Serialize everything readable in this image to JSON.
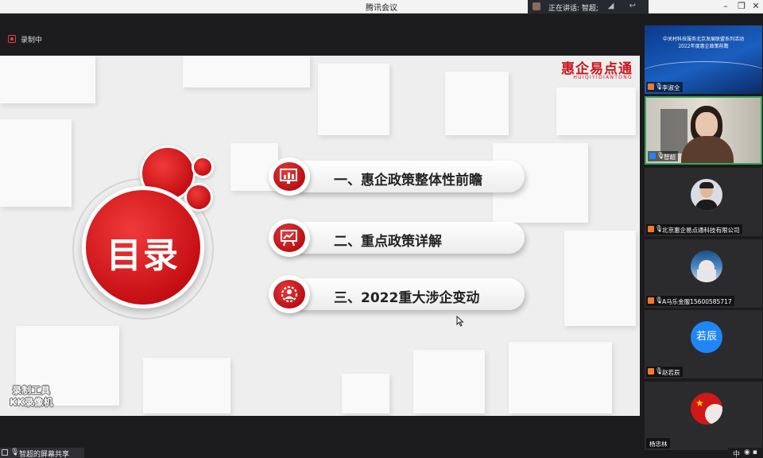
{
  "window": {
    "title": "腾讯会议"
  },
  "speaking": {
    "label": "正在讲话: 智超;"
  },
  "recording": {
    "label": "录制中"
  },
  "slide": {
    "brand_cn": "惠企易点通",
    "brand_en": "HUIQIYIDIANTONG",
    "toc_title": "目录",
    "items": [
      {
        "label": "一、惠企政策整体性前瞻",
        "icon": "monitor-chart-icon"
      },
      {
        "label": "二、重点政策详解",
        "icon": "presentation-board-icon"
      },
      {
        "label": "三、2022重大涉企变动",
        "icon": "person-gear-icon"
      }
    ]
  },
  "watermark": {
    "line1": "录制工具",
    "line2": "KK录像机"
  },
  "share": {
    "label": "智超的屏幕共享"
  },
  "participants": [
    {
      "name": "李淑全",
      "type": "banner",
      "banner_line1": "中关村科技服务北京发展联盟系列活动",
      "banner_line2": "2022年度惠企政策前瞻"
    },
    {
      "name": "智超",
      "type": "video",
      "speaking": true
    },
    {
      "name": "北京惠企易点通科技有限公司",
      "type": "photo"
    },
    {
      "name": "A马乐金服15600585717",
      "type": "photo"
    },
    {
      "name": "赵若辰",
      "type": "text",
      "avatar_text": "若辰"
    },
    {
      "name": "杨忠林",
      "type": "photo"
    }
  ],
  "bottom_indicator": "中",
  "colors": {
    "accent_red": "#c8161d",
    "speaker_border": "#3aa35a",
    "avatar_blue": "#1f86f5"
  }
}
